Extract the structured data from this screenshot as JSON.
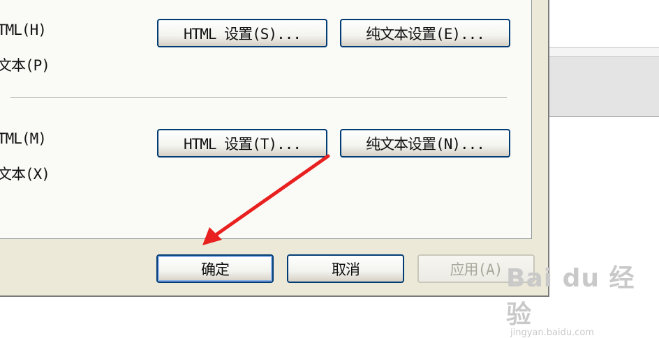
{
  "options": {
    "group1": {
      "opt_html": "TML(H)",
      "opt_text": "文本(P)",
      "html_settings_button": "HTML 设置(S)...",
      "text_settings_button": "纯文本设置(E)..."
    },
    "group2": {
      "opt_html": "TML(M)",
      "opt_text": "文本(X)",
      "html_settings_button": "HTML 设置(T)...",
      "text_settings_button": "纯文本设置(N)..."
    }
  },
  "footer": {
    "ok_label": "确定",
    "cancel_label": "取消",
    "apply_label": "应用(A)"
  },
  "watermark": {
    "main": "Bai du 经验",
    "sub": "jingyan.baidu.com"
  },
  "colors": {
    "annotation_arrow": "#e8201f"
  }
}
